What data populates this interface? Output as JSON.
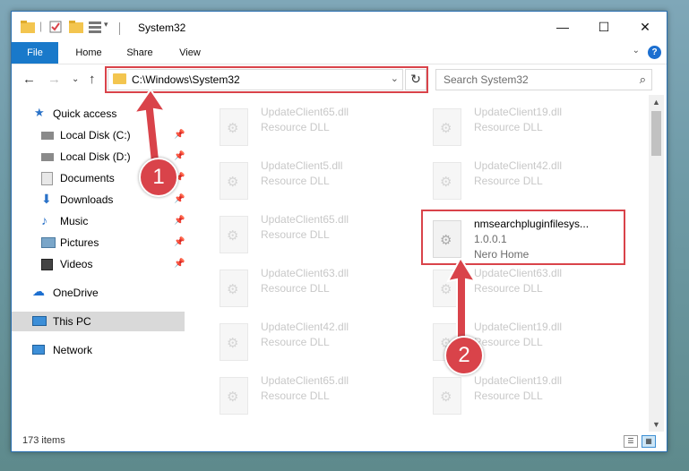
{
  "window": {
    "title": "System32",
    "controls": {
      "minimize": "—",
      "maximize": "☐",
      "close": "✕"
    }
  },
  "ribbon": {
    "tabs": [
      "File",
      "Home",
      "Share",
      "View"
    ],
    "help": "?"
  },
  "address_bar": {
    "path": "C:\\Windows\\System32",
    "search_placeholder": "Search System32"
  },
  "sidebar": {
    "items": [
      {
        "label": "Quick access",
        "icon": "star-icon",
        "pinned": false
      },
      {
        "label": "Local Disk (C:)",
        "icon": "drive-icon",
        "pinned": true
      },
      {
        "label": "Local Disk (D:)",
        "icon": "drive-icon",
        "pinned": true
      },
      {
        "label": "Documents",
        "icon": "documents-icon",
        "pinned": true
      },
      {
        "label": "Downloads",
        "icon": "download-icon",
        "pinned": true
      },
      {
        "label": "Music",
        "icon": "music-icon",
        "pinned": true
      },
      {
        "label": "Pictures",
        "icon": "pictures-icon",
        "pinned": true
      },
      {
        "label": "Videos",
        "icon": "videos-icon",
        "pinned": true
      },
      {
        "label": "OneDrive",
        "icon": "cloud-icon",
        "pinned": false
      },
      {
        "label": "This PC",
        "icon": "computer-icon",
        "pinned": false,
        "selected": true
      },
      {
        "label": "Network",
        "icon": "network-icon",
        "pinned": false
      }
    ]
  },
  "files": {
    "left_column": [
      {
        "name": "UpdateClient65.dll",
        "type": "Resource DLL"
      },
      {
        "name": "UpdateClient5.dll",
        "type": "Resource DLL"
      },
      {
        "name": "UpdateClient65.dll",
        "type": "Resource DLL"
      },
      {
        "name": "UpdateClient63.dll",
        "type": "Resource DLL"
      },
      {
        "name": "UpdateClient42.dll",
        "type": "Resource DLL"
      },
      {
        "name": "UpdateClient65.dll",
        "type": "Resource DLL"
      }
    ],
    "right_column": [
      {
        "name": "UpdateClient19.dll",
        "type": "Resource DLL"
      },
      {
        "name": "UpdateClient42.dll",
        "type": "Resource DLL"
      },
      {
        "name": "nmsearchpluginfilesys...",
        "version": "1.0.0.1",
        "company": "Nero Home",
        "highlighted": true
      },
      {
        "name": "UpdateClient63.dll",
        "type": "Resource DLL"
      },
      {
        "name": "UpdateClient19.dll",
        "type": "Resource DLL"
      },
      {
        "name": "UpdateClient19.dll",
        "type": "Resource DLL"
      }
    ]
  },
  "status": {
    "item_count": "173 items"
  },
  "annotations": {
    "step1": "1",
    "step2": "2",
    "highlight_color": "#d9434a"
  }
}
